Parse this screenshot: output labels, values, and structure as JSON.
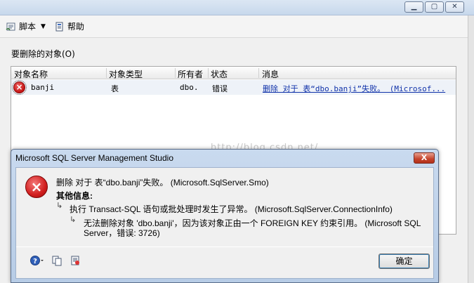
{
  "toolbar": {
    "script_label": "脚本",
    "help_label": "帮助"
  },
  "section": {
    "label": "要删除的对象(O)"
  },
  "grid": {
    "columns": [
      "对象名称",
      "对象类型",
      "所有者",
      "状态",
      "消息"
    ],
    "rows": [
      {
        "name": "banji",
        "type": "表",
        "owner": "dbo.",
        "status": "错误",
        "message": "删除 对于 表“dbo.banji”失败。 (Microsof..."
      }
    ]
  },
  "watermark": "http://blog.csdn.net/",
  "dialog": {
    "title": "Microsoft SQL Server Management Studio",
    "close_label": "X",
    "main_message": "删除 对于 表“dbo.banji”失败。  (Microsoft.SqlServer.Smo)",
    "extra_info_heading": "其他信息:",
    "detail1": "执行 Transact-SQL 语句或批处理时发生了异常。 (Microsoft.SqlServer.ConnectionInfo)",
    "detail2_line1": "无法删除对象 'dbo.banji'，因为该对象正由一个 FOREIGN KEY 约束引用。 (Microsoft SQL",
    "detail2_line2": "Server，错误: 3726)",
    "ok_label": "确定"
  },
  "colors": {
    "error_red": "#c41414",
    "link_blue": "#1133aa",
    "title_gradient": "#c9daef"
  }
}
